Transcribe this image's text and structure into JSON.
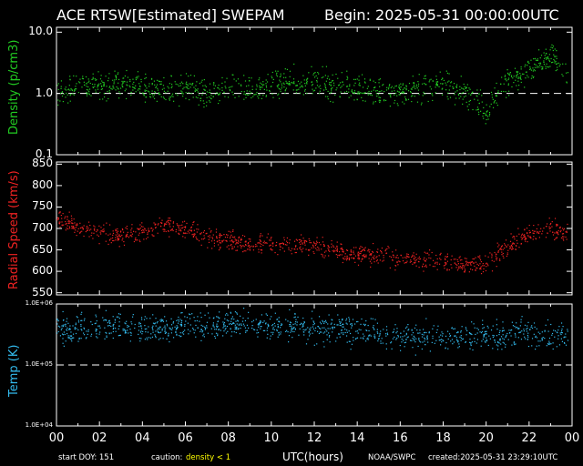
{
  "header": {
    "left": "ACE RTSW[Estimated] SWEPAM",
    "right": "Begin: 2025-05-31 00:00:00UTC"
  },
  "footer": {
    "start_doy": "start DOY: 151",
    "caution_label": "caution:",
    "caution_value": "density < 1",
    "xaxis_title": "UTC(hours)",
    "source": "NOAA/SWPC",
    "created": "created:2025-05-31 23:29:10UTC"
  },
  "colors": {
    "density": "#22cc22",
    "speed": "#ee2222",
    "temp": "#33bbee",
    "caution": "#ffff00",
    "frame": "#ffffff"
  },
  "chart_data": [
    {
      "type": "scatter",
      "ylabel": "Density (p/cm3)",
      "yscale": "log",
      "ylim": [
        0.1,
        12
      ],
      "yticks": [
        "10.0",
        "1.0",
        "0.1"
      ],
      "reference_line": 1.0,
      "xlim": [
        0,
        24
      ],
      "series": [
        {
          "x": [
            0,
            1,
            2,
            3,
            4,
            5,
            6,
            7,
            8,
            9,
            10,
            11,
            12,
            13,
            14,
            15,
            16,
            17,
            18,
            19,
            20,
            21,
            22,
            23,
            23.8
          ],
          "y": [
            1.0,
            1.4,
            1.3,
            1.5,
            1.3,
            1.1,
            1.2,
            1.0,
            1.3,
            1.1,
            1.4,
            1.6,
            1.5,
            1.4,
            1.2,
            1.0,
            1.1,
            1.2,
            1.5,
            1.0,
            0.5,
            1.6,
            2.5,
            4.0,
            1.8
          ]
        }
      ]
    },
    {
      "type": "scatter",
      "ylabel": "Radial Speed (km/s)",
      "ylim": [
        545,
        855
      ],
      "yticks": [
        850,
        800,
        750,
        700,
        650,
        600,
        550
      ],
      "xlim": [
        0,
        24
      ],
      "series": [
        {
          "x": [
            0,
            1,
            2,
            3,
            4,
            5,
            6,
            7,
            8,
            9,
            10,
            11,
            12,
            13,
            14,
            15,
            16,
            17,
            18,
            19,
            20,
            21,
            22,
            23,
            23.8
          ],
          "y": [
            730,
            700,
            690,
            685,
            690,
            710,
            700,
            680,
            670,
            665,
            665,
            660,
            660,
            650,
            640,
            640,
            630,
            625,
            625,
            620,
            620,
            660,
            690,
            700,
            690
          ]
        }
      ]
    },
    {
      "type": "scatter",
      "ylabel": "Temp (K)",
      "yscale": "log",
      "ylim": [
        10000,
        1000000
      ],
      "yticks": [
        "1.0E+06",
        "1.0E+05",
        "1.0E+04"
      ],
      "reference_line": 100000,
      "xlim": [
        0,
        24
      ],
      "series": [
        {
          "x": [
            0,
            1,
            2,
            3,
            4,
            5,
            6,
            7,
            8,
            9,
            10,
            11,
            12,
            13,
            14,
            15,
            16,
            17,
            18,
            19,
            20,
            21,
            22,
            23,
            23.8
          ],
          "y": [
            400000,
            380000,
            420000,
            430000,
            390000,
            410000,
            430000,
            450000,
            480000,
            470000,
            460000,
            450000,
            400000,
            380000,
            370000,
            330000,
            310000,
            300000,
            320000,
            290000,
            300000,
            320000,
            330000,
            300000,
            310000
          ]
        }
      ]
    }
  ],
  "xticks": [
    "00",
    "02",
    "04",
    "06",
    "08",
    "10",
    "12",
    "14",
    "16",
    "18",
    "20",
    "22",
    "00"
  ]
}
